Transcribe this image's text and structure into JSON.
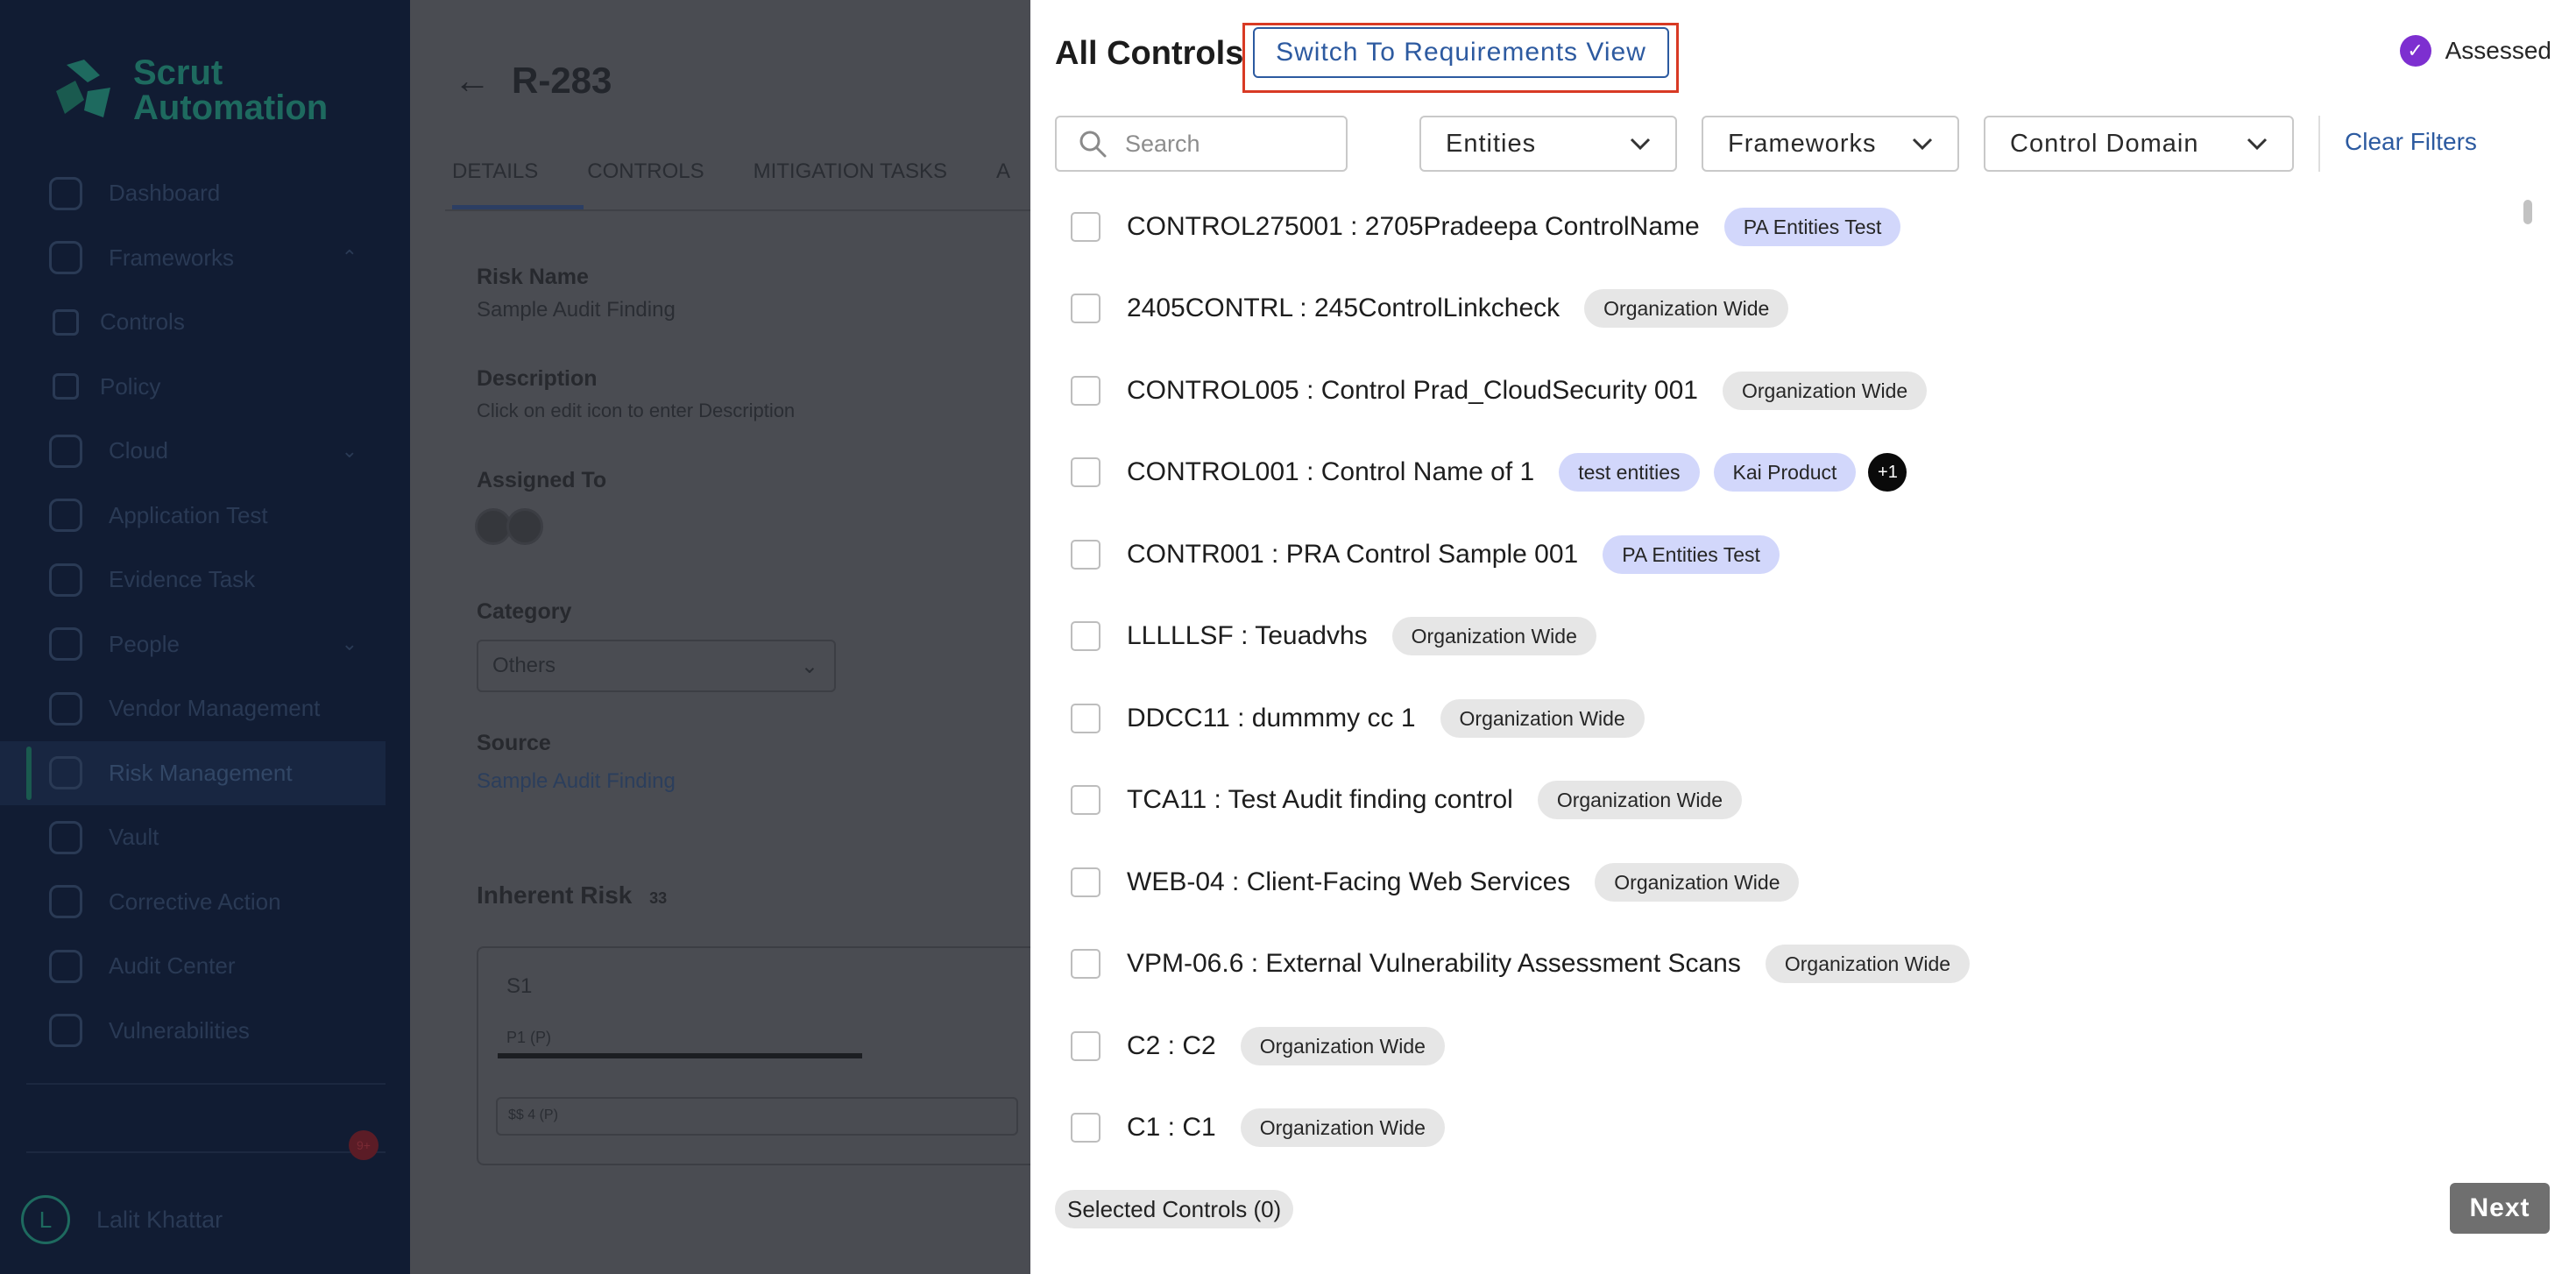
{
  "sidebar": {
    "brand": "Scrut\nAutomation",
    "brand_line1": "Scrut",
    "brand_line2": "Automation",
    "items": [
      {
        "label": "Dashboard"
      },
      {
        "label": "Frameworks"
      },
      {
        "label": "Controls"
      },
      {
        "label": "Policy"
      },
      {
        "label": "Cloud"
      },
      {
        "label": "Application Test"
      },
      {
        "label": "Evidence Task"
      },
      {
        "label": "People"
      },
      {
        "label": "Vendor Management"
      },
      {
        "label": "Risk Management"
      },
      {
        "label": "Vault"
      },
      {
        "label": "Corrective Action"
      },
      {
        "label": "Audit Center"
      },
      {
        "label": "Vulnerabilities"
      }
    ],
    "user_initial": "L",
    "user_name": "Lalit Khattar",
    "notification_count": "9+"
  },
  "background": {
    "title": "R-283",
    "tabs": [
      "DETAILS",
      "CONTROLS",
      "MITIGATION TASKS",
      "A"
    ],
    "risk_name_label": "Risk Name",
    "risk_name_value": "Sample Audit Finding",
    "description_label": "Description",
    "description_placeholder": "Click on edit icon to enter Description",
    "assigned_label": "Assigned To",
    "category_label": "Category",
    "category_value": "Others",
    "source_label": "Source",
    "source_value": "Sample Audit Finding",
    "inherent_risk_label": "Inherent Risk",
    "inherent_risk_value": "33",
    "score_label": "S1",
    "prob_label": "P1 (P)",
    "impact_label": "$$ 4 (P)"
  },
  "modal": {
    "title": "All Controls",
    "switch_button": "Switch To Requirements View",
    "assessed_label": "Assessed",
    "search_placeholder": "Search",
    "filters": {
      "entities": "Entities",
      "frameworks": "Frameworks",
      "control_domain": "Control Domain",
      "clear": "Clear Filters"
    },
    "controls": [
      {
        "text": "CONTROL275001 : 2705Pradeepa ControlName",
        "tags": [
          {
            "label": "PA Entities Test",
            "style": "blue"
          }
        ]
      },
      {
        "text": "2405CONTRL : 245ControlLinkcheck",
        "tags": [
          {
            "label": "Organization Wide",
            "style": "grey"
          }
        ]
      },
      {
        "text": "CONTROL005 : Control Prad_CloudSecurity 001",
        "tags": [
          {
            "label": "Organization Wide",
            "style": "grey"
          }
        ]
      },
      {
        "text": "CONTROL001 : Control Name of 1",
        "tags": [
          {
            "label": "test entities",
            "style": "blue"
          },
          {
            "label": "Kai Product",
            "style": "blue"
          }
        ],
        "more": "+1"
      },
      {
        "text": "CONTR001 : PRA Control Sample 001",
        "tags": [
          {
            "label": "PA Entities Test",
            "style": "blue"
          }
        ]
      },
      {
        "text": "LLLLLSF : Teuadvhs",
        "tags": [
          {
            "label": "Organization Wide",
            "style": "grey"
          }
        ]
      },
      {
        "text": "DDCC11 : dummmy cc 1",
        "tags": [
          {
            "label": "Organization Wide",
            "style": "grey"
          }
        ]
      },
      {
        "text": "TCA11 : Test Audit finding control",
        "tags": [
          {
            "label": "Organization Wide",
            "style": "grey"
          }
        ]
      },
      {
        "text": "WEB-04 : Client-Facing Web Services",
        "tags": [
          {
            "label": "Organization Wide",
            "style": "grey"
          }
        ]
      },
      {
        "text": "VPM-06.6 : External Vulnerability Assessment Scans",
        "tags": [
          {
            "label": "Organization Wide",
            "style": "grey"
          }
        ]
      },
      {
        "text": "C2 : C2",
        "tags": [
          {
            "label": "Organization Wide",
            "style": "grey"
          }
        ]
      },
      {
        "text": "C1 : C1",
        "tags": [
          {
            "label": "Organization Wide",
            "style": "grey"
          }
        ]
      }
    ],
    "selected_label": "Selected Controls (0)",
    "next_button": "Next"
  },
  "colors": {
    "accent": "#2c5aa0",
    "highlight": "#d83a24",
    "assessed": "#7d2fd0",
    "tag_blue": "#d2d7fb",
    "tag_grey": "#e6e6e6"
  }
}
